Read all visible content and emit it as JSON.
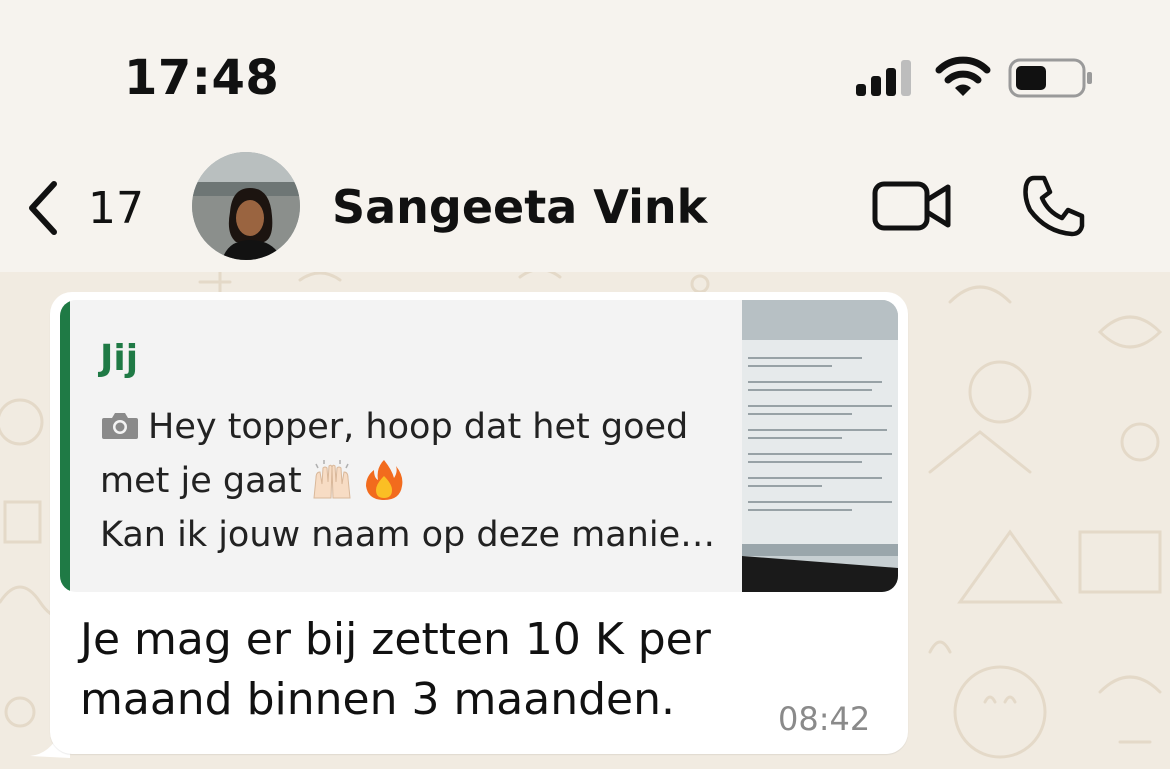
{
  "status_bar": {
    "time": "17:48"
  },
  "header": {
    "back_count": "17",
    "contact_name": "Sangeeta Vink"
  },
  "message": {
    "quote": {
      "author": "Jij",
      "line1": "Hey topper, hoop dat het goed",
      "line2": "met je gaat",
      "line3": "Kan ik jouw naam op deze manie…"
    },
    "text_line1": "Je mag er bij zetten 10 K per",
    "text_line2": "maand binnen 3 maanden.",
    "time": "08:42"
  },
  "icons": {
    "back": "chevron-left-icon",
    "video": "video-camera-icon",
    "call": "phone-icon",
    "camera": "camera-icon",
    "raising_hands": "raising-hands-emoji",
    "fire": "fire-emoji"
  },
  "colors": {
    "background": "#f6f3ee",
    "wallpaper": "#f1ebe1",
    "quote_accent": "#1f7a45",
    "bubble": "#ffffff"
  }
}
